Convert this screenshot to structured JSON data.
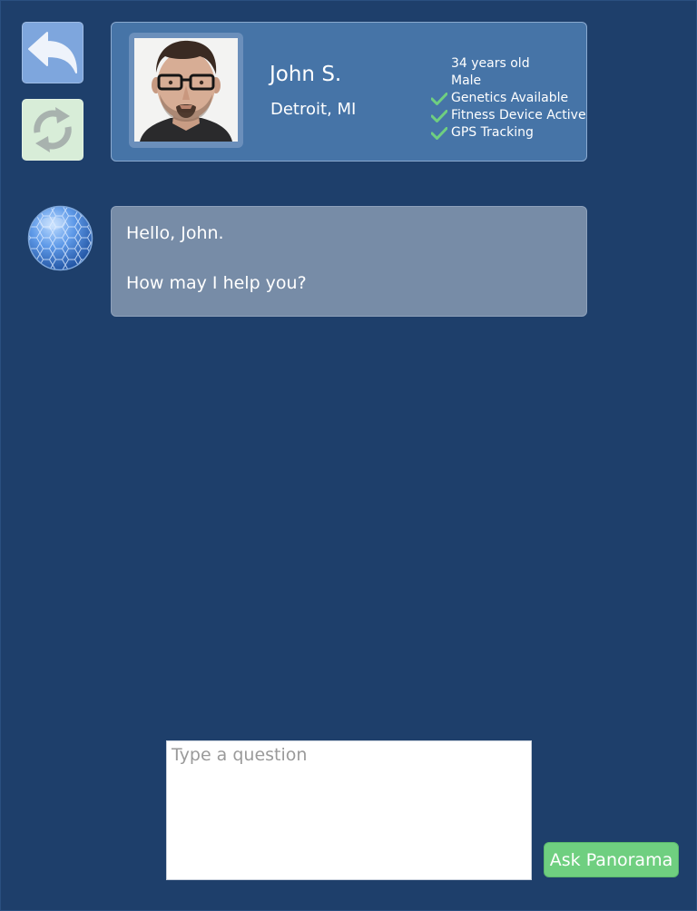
{
  "profile": {
    "name": "John S.",
    "location": "Detroit, MI",
    "age": "34 years old",
    "gender": "Male",
    "features": [
      {
        "label": "Genetics Available",
        "checked": true
      },
      {
        "label": "Fitness Device Active",
        "checked": true
      },
      {
        "label": "GPS Tracking",
        "checked": true
      }
    ]
  },
  "chat": {
    "messages": [
      {
        "lines": [
          "Hello, John.",
          "How may I help you?"
        ]
      }
    ]
  },
  "input": {
    "placeholder": "Type a question",
    "value": ""
  },
  "actions": {
    "ask_label": "Ask Panorama"
  },
  "icons": {
    "back": "back-arrow-icon",
    "refresh": "refresh-icon",
    "check": "checkmark-icon",
    "assistant": "hexagon-sphere-icon"
  },
  "colors": {
    "background": "#1e3f6b",
    "card": "#4674a7",
    "bubble": "#778ca7",
    "ask_button": "#6fcf80",
    "check": "#6fcf80"
  }
}
